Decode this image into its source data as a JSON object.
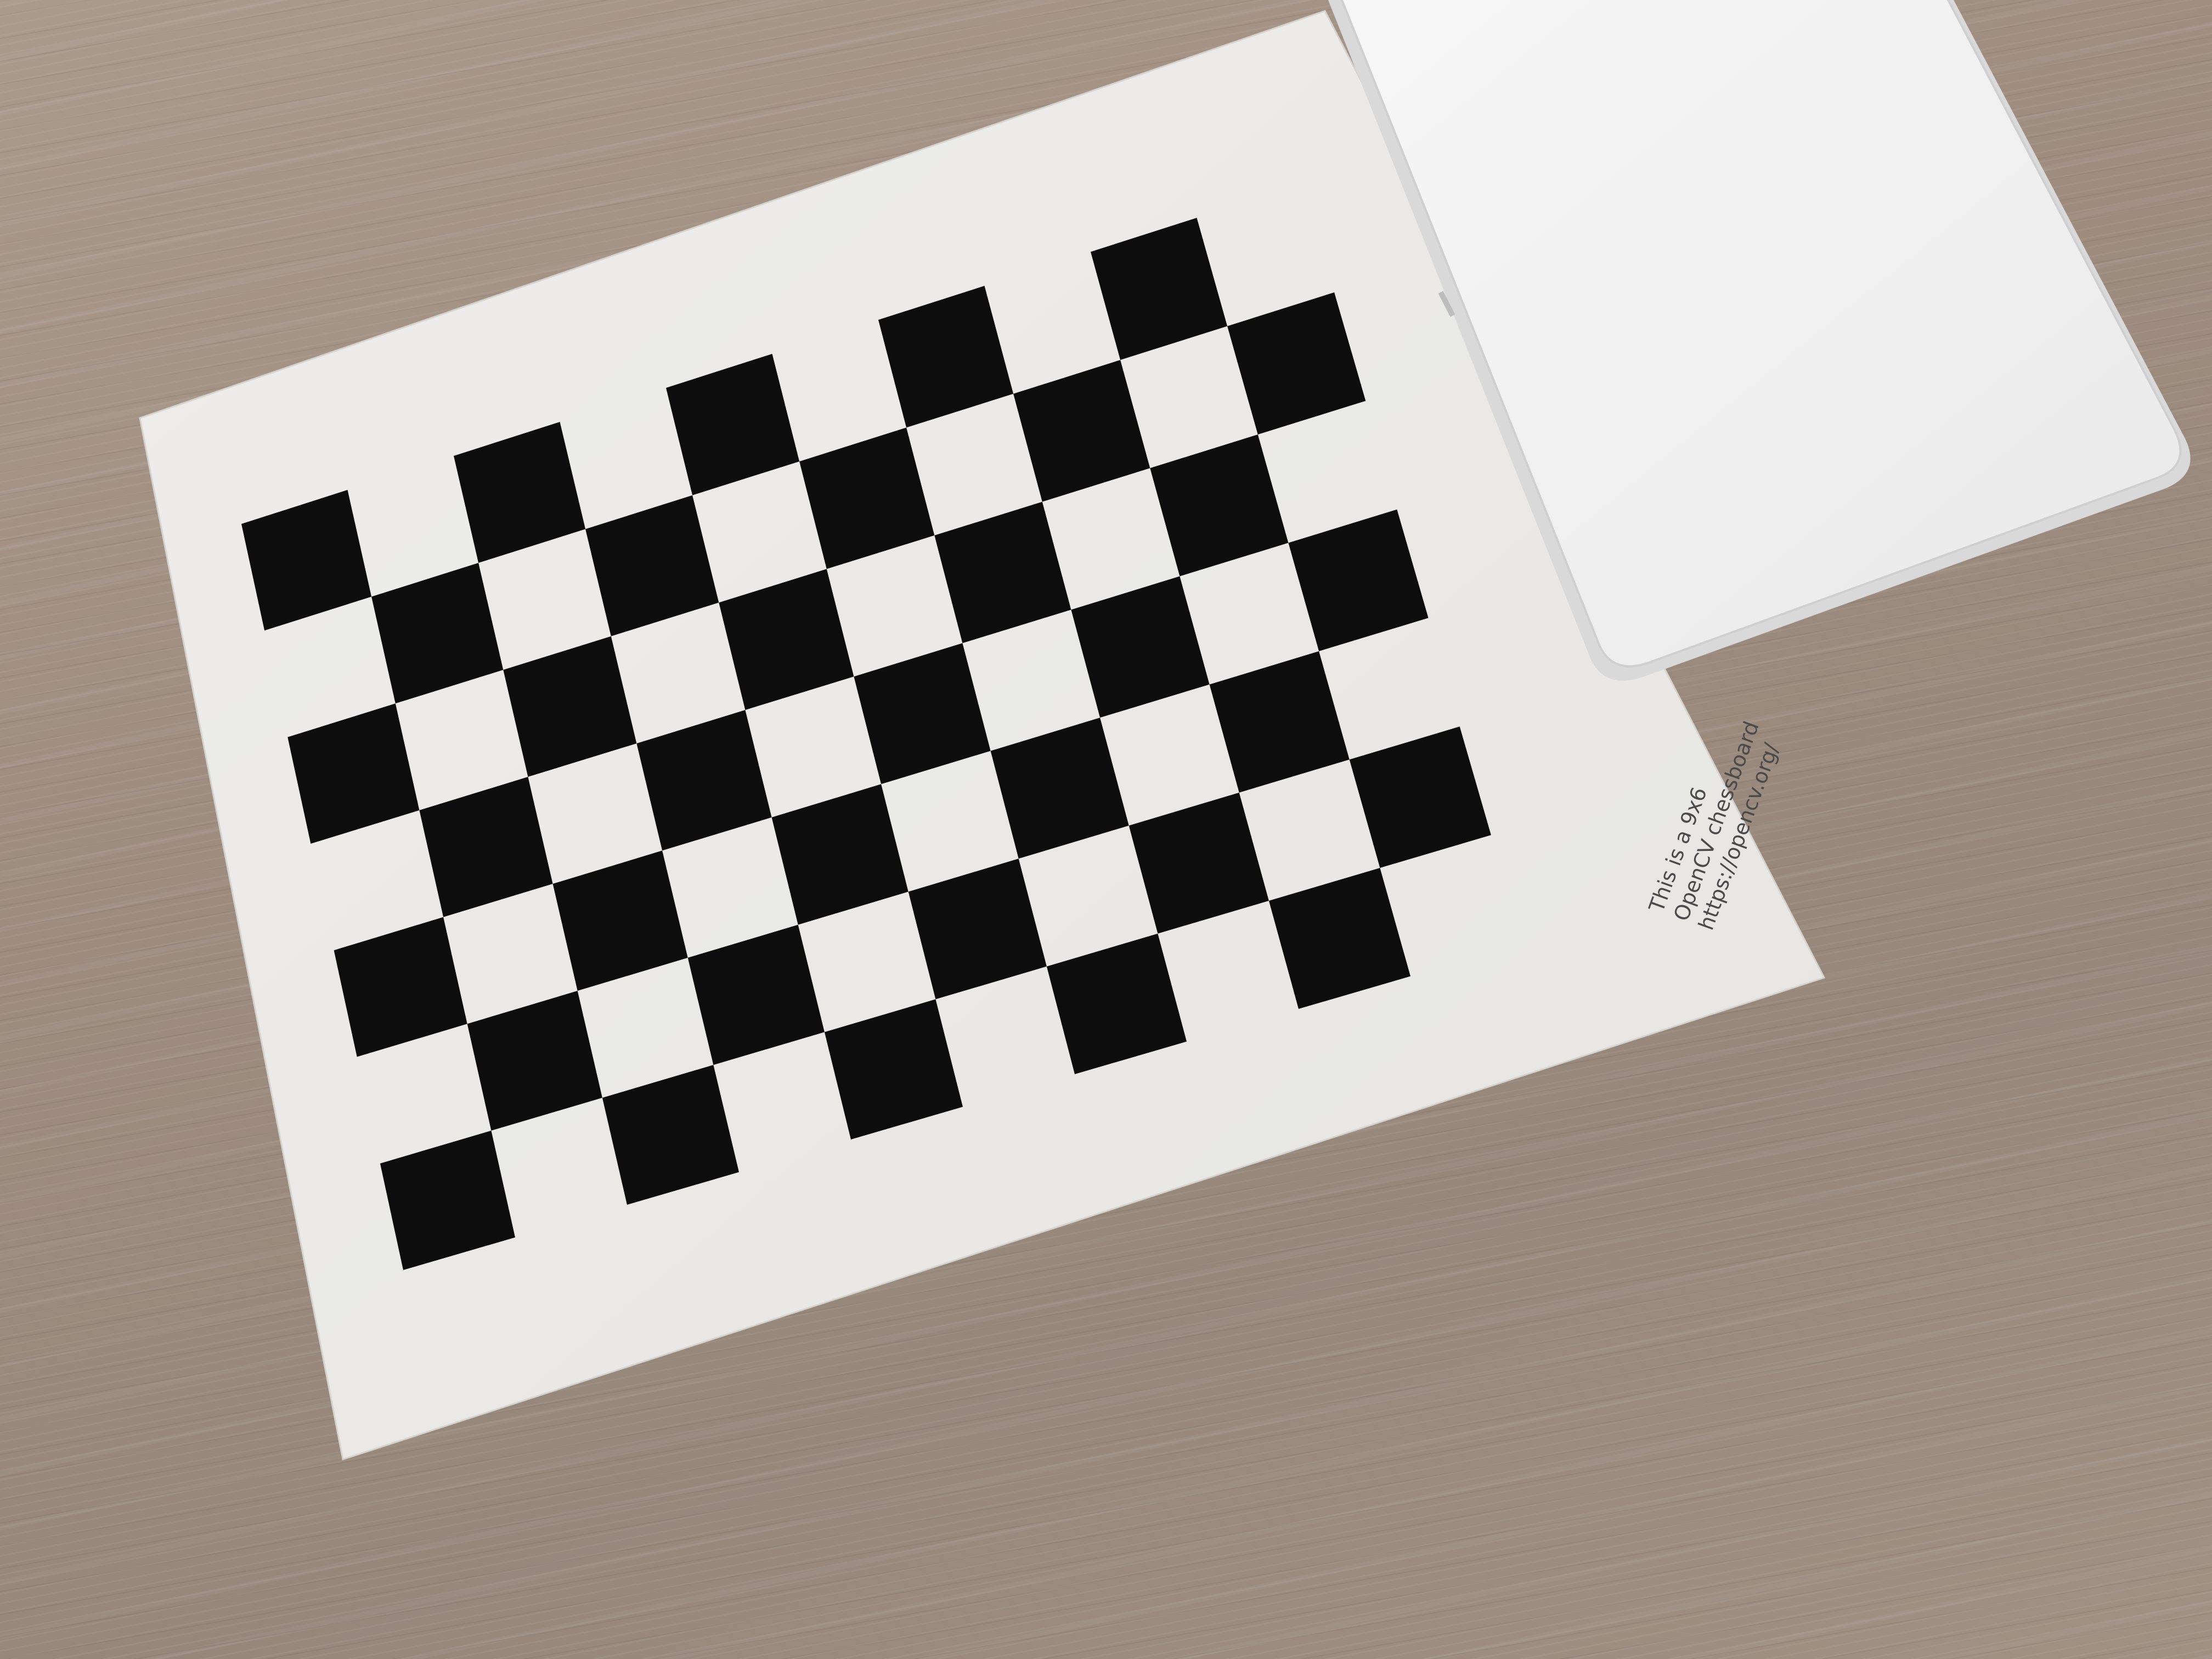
{
  "scene": {
    "description_tag": "photo-of-printed-calibration-chessboard",
    "board_pattern": "9x6",
    "square_rows": 7,
    "square_cols": 10,
    "colors": {
      "paper": "#ecebe8",
      "square": "#0d0d0e",
      "table": "#9d8c7e",
      "device": "#f3f3f3"
    }
  },
  "caption": {
    "line1": "This is a 9x6",
    "line2": "OpenCV chessboard",
    "line3": "https://opencv.org/"
  }
}
